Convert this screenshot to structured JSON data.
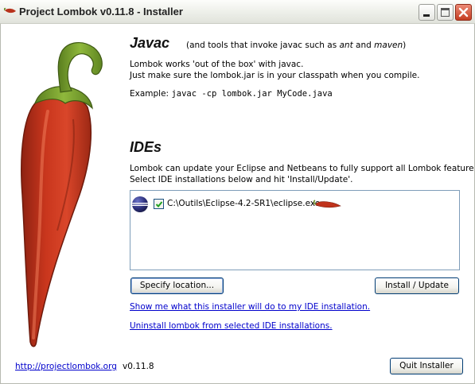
{
  "window": {
    "title": "Project Lombok v0.11.8 - Installer",
    "icon": "pepper-icon"
  },
  "javac": {
    "heading": "Javac",
    "note_prefix": "(and tools that invoke javac such as ",
    "note_ant": "ant",
    "note_middle": " and ",
    "note_maven": "maven",
    "note_suffix": ")",
    "line1": "Lombok works 'out of the box' with javac.",
    "line2": "Just make sure the lombok.jar is in your classpath when you compile.",
    "example_label": "Example: ",
    "example_code": "javac -cp lombok.jar MyCode.java"
  },
  "ides": {
    "heading": "IDEs",
    "line1": "Lombok can update your Eclipse and Netbeans to fully support all Lombok features.",
    "line2": "Select IDE installations below and hit 'Install/Update'.",
    "installations": [
      {
        "path": "C:\\Outils\\Eclipse-4.2-SR1\\eclipse.exe",
        "checked": true,
        "icon": "eclipse-icon",
        "status_icon": "pepper-icon"
      }
    ]
  },
  "buttons": {
    "specify": "Specify location...",
    "install": "Install / Update",
    "quit": "Quit Installer"
  },
  "links": {
    "show": "Show me what this installer will do to my IDE installation.",
    "uninstall": "Uninstall lombok from selected IDE installations.",
    "site": "http://projectlombok.org"
  },
  "version": "v0.11.8",
  "colors": {
    "pepper_red": "#c0331c",
    "stem_green": "#7aa531",
    "link_blue": "#0000cc",
    "titlebar": "#eef0ea"
  }
}
